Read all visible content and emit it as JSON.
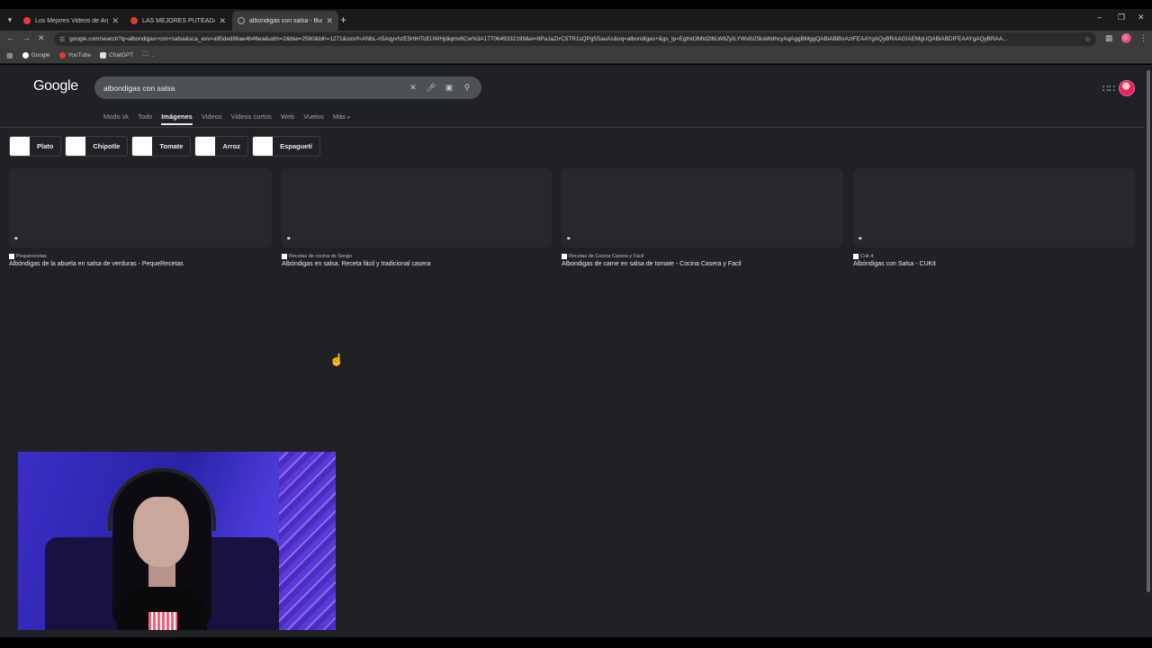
{
  "browser": {
    "tabs": [
      {
        "title": "Los Mejores Videos de Argentin",
        "favicon": "youtube-icon",
        "active": false
      },
      {
        "title": "LAS MEJORES PUTEADAS DE T",
        "favicon": "youtube-icon",
        "active": false
      },
      {
        "title": "albondigas con salsa - Buscar c",
        "favicon": "google-icon",
        "active": true
      }
    ],
    "url": "google.com/search?q=albondigas+con+salsa&sca_esv=a95ded86ae4b46ea&udm=2&biw=2560&bih=1271&sxsrf=ANbL-n5AqyvhzE5HtHTcEUWHjdiqmv6Cw%3A1770649332199&ei=9PaJaZrrC5TR1sQPg5SauAs&oq=albondigas+&gs_lp=Egtnd3Mtd2l6LWltZyILYWxib25kaWdhcyAqAggBMggQABiABBixAzIFEAAYgAQyBRAAGIAEMgUQABiABDIFEAAYgAQyBRAA...",
    "bookmarks": [
      "Google",
      "YouTube",
      "ChatGPT",
      ".."
    ]
  },
  "google": {
    "logo": "Google",
    "query": "albondigas con salsa",
    "nav_tabs": [
      "Modo IA",
      "Todo",
      "Imágenes",
      "Videos",
      "Videos cortos",
      "Web",
      "Vuelos",
      "Más"
    ],
    "active_tab": "Imágenes",
    "chips": [
      "Plato",
      "Chipotle",
      "Tomate",
      "Arroz",
      "Espagueti"
    ],
    "results": [
      {
        "source": "Pequerecetas",
        "title": "Albóndigas de la abuela en salsa de verduras - PequeRecetas"
      },
      {
        "source": "Recetas de cocina de Sergio",
        "title": "Albóndigas en salsa. Receta fácil y tradicional casera"
      },
      {
        "source": "Recetas de Cocina Casera y Fácil",
        "title": "Albondigas de carne en salsa de tomate - Cocina Casera y Facil"
      },
      {
        "source": "Cuk-it",
        "title": "Albóndigas con Salsa - CUKit"
      }
    ]
  },
  "colors": {
    "page_bg": "#202124",
    "search_bg": "#4d5156",
    "chrome_bg": "#3b3b3b"
  }
}
